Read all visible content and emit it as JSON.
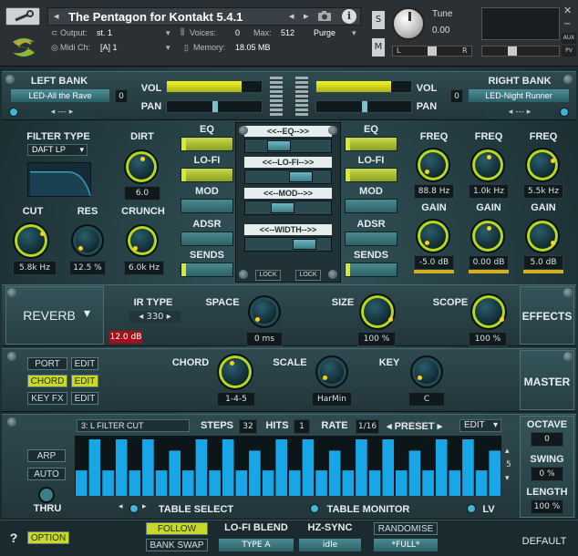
{
  "header": {
    "instrument_title": "The Pentagon for Kontakt 5.4.1",
    "output_label": "Output:",
    "output_value": "st. 1",
    "voices_label": "Voices:",
    "voices_value": "0",
    "max_label": "Max:",
    "max_value": "512",
    "purge_label": "Purge",
    "midi_label": "Midi Ch:",
    "midi_value": "[A] 1",
    "memory_label": "Memory:",
    "memory_value": "18.05 MB",
    "tune_label": "Tune",
    "tune_value": "0.00",
    "s_label": "S",
    "m_label": "M",
    "aux_label": "AUX",
    "pv_label": "PV",
    "l_label": "L",
    "r_label": "R"
  },
  "banks": {
    "left_title": "LEFT BANK",
    "left_preset": "LED-All the Rave",
    "left_index": "0",
    "left_nav": "---",
    "right_title": "RIGHT BANK",
    "right_preset": "LED-Night Runner",
    "right_index": "0",
    "right_nav": "---",
    "vol": "VOL",
    "pan": "PAN"
  },
  "filter": {
    "type_label": "FILTER TYPE",
    "type_value": "DAFT LP",
    "dirt_label": "DIRT",
    "dirt_value": "6.0",
    "cut_label": "CUT",
    "cut_value": "5.8k Hz",
    "res_label": "RES",
    "res_value": "12.5 %",
    "crunch_label": "CRUNCH",
    "crunch_value": "6.0k Hz"
  },
  "sections_left": [
    "EQ",
    "LO-FI",
    "MOD",
    "ADSR",
    "SENDS"
  ],
  "sections_right": [
    "EQ",
    "LO-FI",
    "MOD",
    "ADSR",
    "SENDS"
  ],
  "center_strips": [
    "<<--EQ-->>",
    "<<--LO-FI-->>",
    "<<--MOD-->>",
    "<<--WIDTH-->>"
  ],
  "lock_label": "LOCK",
  "eq": {
    "freq_label": "FREQ",
    "gain_label": "GAIN",
    "freq_values": [
      "88.8 Hz",
      "1.0k Hz",
      "5.5k Hz"
    ],
    "gain_values": [
      "-5.0 dB",
      "0.00 dB",
      "5.0 dB"
    ]
  },
  "reverb": {
    "title": "REVERB",
    "ir_type_label": "IR TYPE",
    "ir_type_value": "330",
    "level_value": "12.0 dB",
    "space_label": "SPACE",
    "space_value": "0 ms",
    "size_label": "SIZE",
    "size_value": "100 %",
    "scope_label": "SCOPE",
    "scope_value": "100 %",
    "effects_label": "EFFECTS"
  },
  "master": {
    "port_label": "PORT",
    "chord_label": "CHORD",
    "keyfx_label": "KEY FX",
    "edit_label": "EDIT",
    "chord_knob_label": "CHORD",
    "chord_value": "1-4-5",
    "scale_label": "SCALE",
    "scale_value": "HarMin",
    "key_label": "KEY",
    "key_value": "C",
    "master_label": "MASTER"
  },
  "seq": {
    "table_name": "3: L FILTER CUT",
    "steps_label": "STEPS",
    "steps_value": "32",
    "hits_label": "HITS",
    "hits_value": "1",
    "rate_label": "RATE",
    "rate_value": "1/16",
    "preset_label": "PRESET",
    "edit_label": "EDIT",
    "arp_label": "ARP",
    "auto_label": "AUTO",
    "thru_label": "THRU",
    "table_select": "TABLE SELECT",
    "table_monitor": "TABLE MONITOR",
    "lv_label": "LV",
    "scroll_value": "5",
    "octave_label": "OCTAVE",
    "octave_value": "0",
    "swing_label": "SWING",
    "swing_value": "0 %",
    "length_label": "LENGTH",
    "length_value": "100 %",
    "bars": [
      0.45,
      1.0,
      0.45,
      1.0,
      0.45,
      1.0,
      0.45,
      0.8,
      0.45,
      1.0,
      0.45,
      1.0,
      0.45,
      0.8,
      0.45,
      1.0,
      0.45,
      1.0,
      0.45,
      0.8,
      0.45,
      1.0,
      0.45,
      1.0,
      0.45,
      0.8,
      0.45,
      1.0,
      0.45,
      1.0,
      0.45,
      0.8
    ]
  },
  "footer": {
    "help": "?",
    "option": "OPTION",
    "follow": "FOLLOW",
    "bank_swap": "BANK SWAP",
    "lofi_blend_label": "LO-FI BLEND",
    "lofi_blend_value": "TYPE A",
    "hz_sync_label": "HZ-SYNC",
    "hz_sync_value": "idle",
    "randomise": "RANDOMISE",
    "full": "*FULL*",
    "default": "DEFAULT"
  },
  "colors": {
    "accent_lime": "#c8d92c",
    "knob_ring": "#b8d91a",
    "seq_bar": "#18a6e6",
    "panel": "#2f4a4f"
  }
}
